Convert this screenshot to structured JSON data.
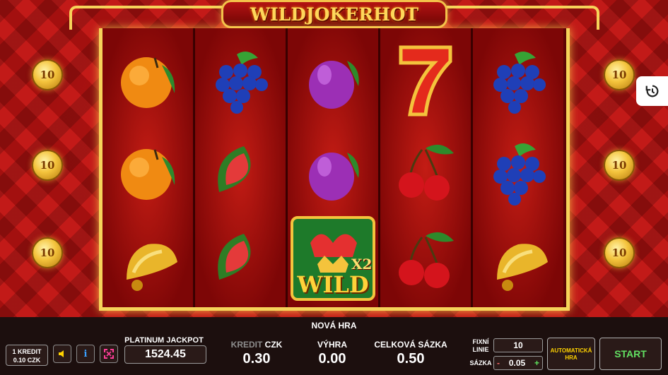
{
  "game": {
    "title": "WILDJOKERHOT"
  },
  "reels": [
    [
      "orange",
      "orange",
      "bell"
    ],
    [
      "grapes",
      "watermelon",
      "watermelon"
    ],
    [
      "plum",
      "plum",
      "wild-joker"
    ],
    [
      "seven",
      "cherries",
      "cherries"
    ],
    [
      "grapes",
      "grapes",
      "bell"
    ]
  ],
  "wild": {
    "label": "WILD",
    "multiplier": "X2"
  },
  "side_coins": {
    "left": [
      "10",
      "10",
      "10"
    ],
    "right": [
      "10",
      "10",
      "10"
    ]
  },
  "panel": {
    "new_game": "NOVÁ HRA",
    "credit_line1": "1 KREDIT",
    "credit_line2": "0.10 CZK",
    "sound_icon": "speaker-icon",
    "info_label": "i",
    "fullscreen_icon": "fullscreen-icon",
    "jackpot_label": "PLATINUM JACKPOT",
    "jackpot_value": "1524.45",
    "kredit_label": "KREDIT",
    "kredit_unit": "CZK",
    "kredit_value": "0.30",
    "vyhra_label": "VÝHRA",
    "vyhra_value": "0.00",
    "celkova_label": "CELKOVÁ SÁZKA",
    "celkova_value": "0.50",
    "fixni_label1": "FIXNÍ",
    "fixni_label2": "LINIE",
    "lines_value": "10",
    "sazka_label": "SÁZKA",
    "sazka_minus": "-",
    "sazka_value": "0.05",
    "sazka_plus": "+",
    "auto_label1": "AUTOMATICKÁ",
    "auto_label2": "HRA",
    "start_label": "START"
  },
  "colors": {
    "gold": "#f6d35a",
    "panel_bg": "#1c0f0e",
    "start_green": "#62e062",
    "auto_yellow": "#ffd200"
  }
}
